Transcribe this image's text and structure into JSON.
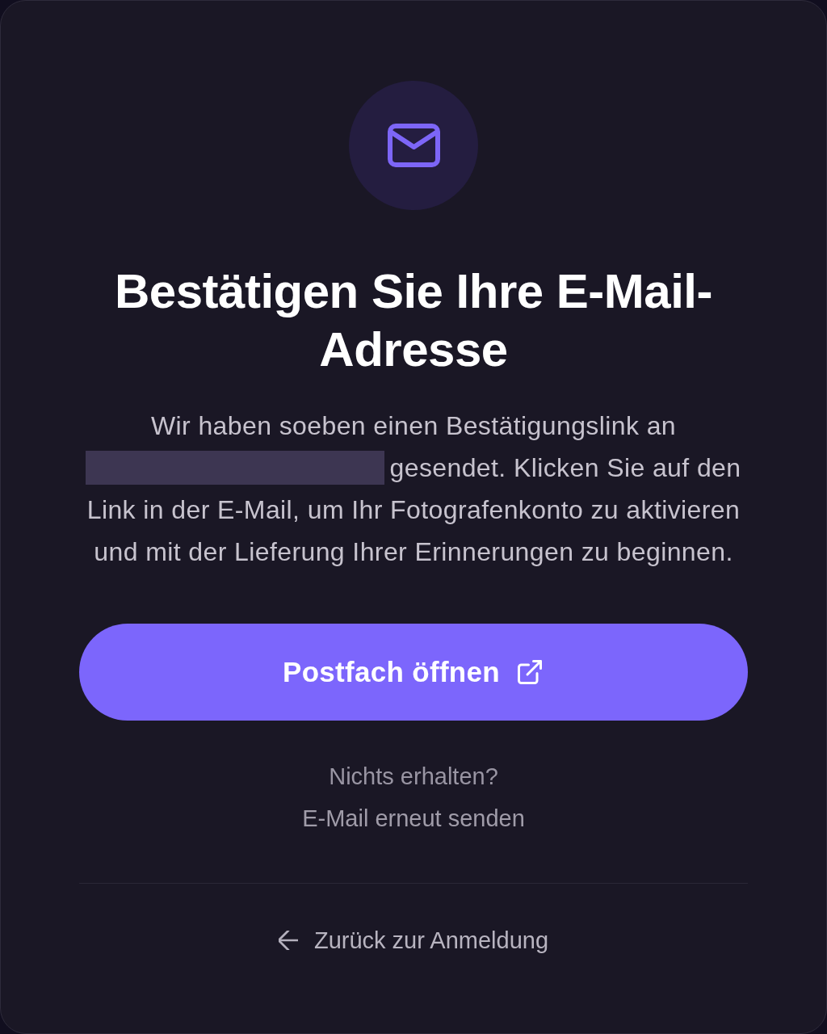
{
  "title": "Bestätigen Sie Ihre E-Mail-Adresse",
  "message": {
    "before_email": "Wir haben soeben einen Bestätigungslink an",
    "after_email": "gesendet. Klicken Sie auf den",
    "continuation": "Link in der E-Mail, um Ihr Fotografenkonto zu aktivieren und mit der Lieferung Ihrer Erinnerungen zu beginnen."
  },
  "primary_button": {
    "label": "Postfach öffnen"
  },
  "resend": {
    "prompt": "Nichts erhalten?",
    "link": "E-Mail erneut senden"
  },
  "back_link": {
    "label": "Zurück zur Anmeldung"
  }
}
